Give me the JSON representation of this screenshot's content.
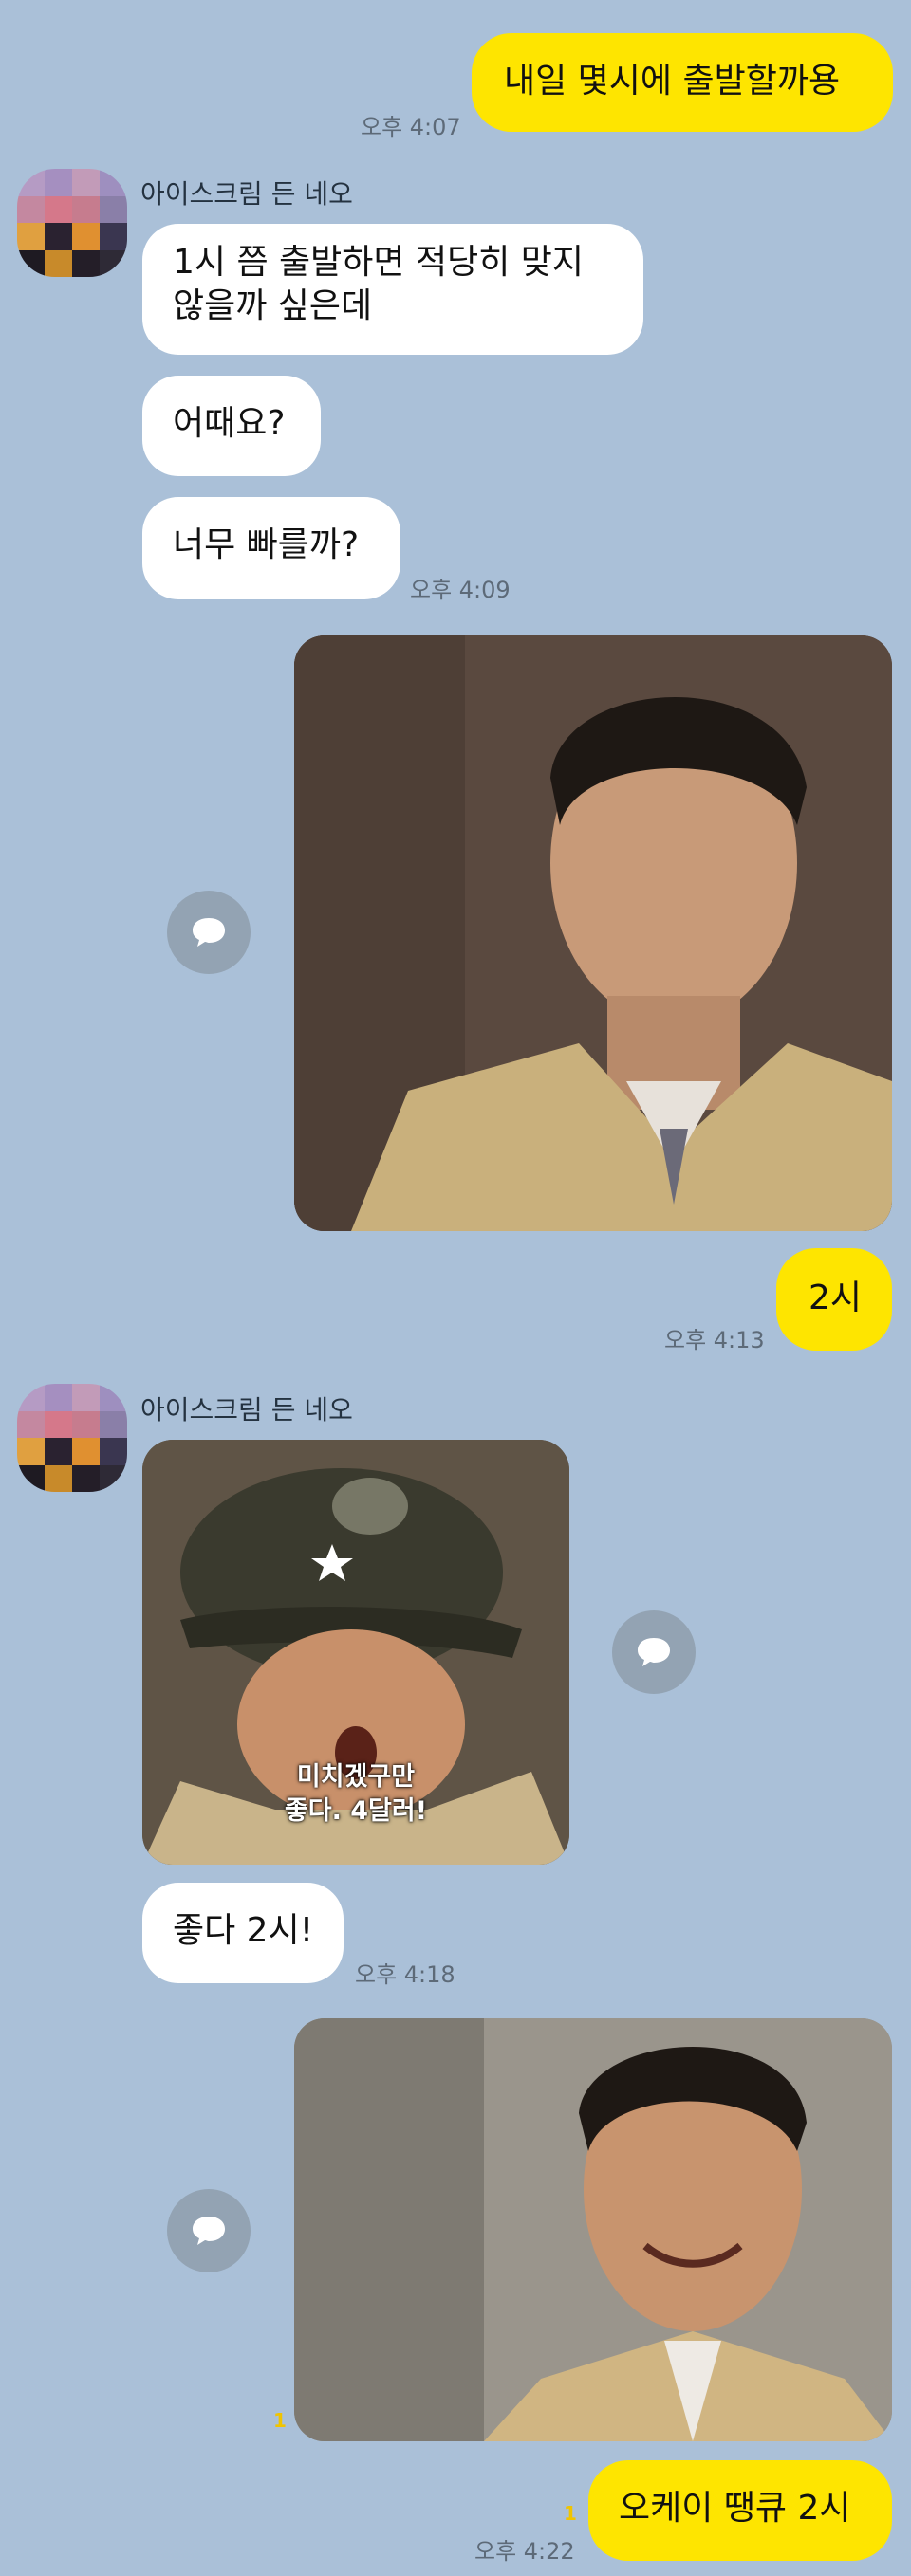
{
  "messages": {
    "m1": {
      "text": "내일 몇시에 출발할까용",
      "time": "오후 4:07"
    },
    "sender1": {
      "name": "아이스크림 든 네오"
    },
    "m2": {
      "line1": "1시 쯤 출발하면 적당히 맞지",
      "line2": "않을까 싶은데"
    },
    "m3": {
      "text": "어때요?"
    },
    "m4": {
      "text": "너무 빠를까?",
      "time": "오후 4:09"
    },
    "m5": {
      "text": "2시",
      "time": "오후 4:13"
    },
    "sender2": {
      "name": "아이스크림 든 네오"
    },
    "sticker": {
      "subtitle_line1": "미치겠구만",
      "subtitle_line2": "좋다. 4달러!"
    },
    "m6": {
      "text": "좋다 2시!",
      "time": "오후 4:18"
    },
    "photo3_unread": "1",
    "m7": {
      "text": "오케이 땡큐 2시",
      "time": "오후 4:22",
      "unread": "1"
    }
  },
  "colors": {
    "background": "#aac0d8",
    "my_bubble": "#fee500",
    "their_bubble": "#ffffff",
    "share_button": "#93a3b3"
  },
  "icons": {
    "share": "speech-bubble-share-icon"
  }
}
